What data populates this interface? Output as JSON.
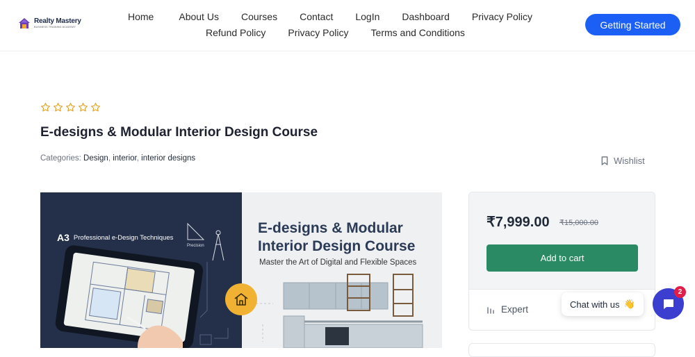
{
  "header": {
    "logo_title": "Realty Mastery",
    "logo_subtitle": "BUSINESS TRAINING ACADEMY",
    "nav_row1": [
      "Home",
      "About Us",
      "Courses",
      "Contact",
      "LogIn",
      "Dashboard",
      "Privacy Policy"
    ],
    "nav_row2": [
      "Refund Policy",
      "Privacy Policy",
      "Terms and Conditions"
    ],
    "cta_label": "Getting Started",
    "cta_color": "#1c5ff5"
  },
  "course": {
    "rating": 0,
    "rating_max": 5,
    "title": "E-designs & Modular Interior Design Course",
    "categories_label": "Categories:",
    "categories": [
      "Design",
      "interior",
      "interior designs"
    ],
    "wishlist_label": "Wishlist"
  },
  "image": {
    "tag": "Professional e-Design Techniques",
    "precision_label": "Precision",
    "headline_line1": "E-designs & Modular",
    "headline_line2": "Interior Design Course",
    "subline": "Master the Art of Digital and Flexible Spaces"
  },
  "pricing": {
    "price": "₹7,999.00",
    "old_price": "₹15,000.00",
    "add_to_cart": "Add to cart",
    "cart_color": "#2a8a64",
    "level": "Expert"
  },
  "chat": {
    "label": "Chat with us",
    "emoji": "👋",
    "badge_count": "2",
    "color": "#3b3ecf"
  }
}
